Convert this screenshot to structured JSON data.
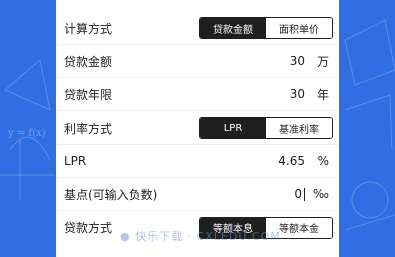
{
  "theme": {
    "background": "#2f6fe3",
    "accent": "#e8a93c",
    "active_segment": "#1f1f1f"
  },
  "form": {
    "calc_method": {
      "label": "计算方式",
      "options": [
        "贷款金额",
        "面积单价"
      ],
      "selected": "贷款金额"
    },
    "loan_amount": {
      "label": "贷款金额",
      "value": "30",
      "unit": "万"
    },
    "loan_term": {
      "label": "贷款年限",
      "value": "30",
      "unit": "年"
    },
    "rate_method": {
      "label": "利率方式",
      "options": [
        "LPR",
        "基准利率"
      ],
      "selected": "LPR"
    },
    "lpr": {
      "label": "LPR",
      "value": "4.65",
      "unit": "%"
    },
    "basis_points": {
      "label": "基点(可输入负数)",
      "value": "0",
      "unit": "‰"
    },
    "repay_method": {
      "label": "贷款方式",
      "options": [
        "等额本息",
        "等额本金"
      ],
      "selected": "等额本息"
    }
  },
  "background_formula": "y = f(x)",
  "watermark": "● 快乐下载 · CXLEDU.COM"
}
